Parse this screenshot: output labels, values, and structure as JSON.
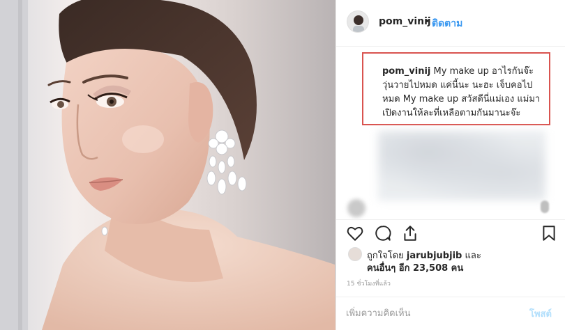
{
  "post": {
    "username": "pom_vinij",
    "follow_label": "ติดตาม",
    "separator": "•",
    "caption": {
      "username": "pom_vinij",
      "text": "My make up อาไรกันจ๊ะ วุ่นวายไปหมด แค่นี้นะ นะฮะ เจ็บคอไปหมด My make up สวัสดีนี่แม่เอง แม่มาเปิดงานให้ละที่เหลือตามกันมานะจ๊ะ"
    },
    "likes": {
      "prefix": "ถูกใจโดย",
      "first_liker": "jarubjubjib",
      "and_label": "และ",
      "others_label": "คนอื่นๆ อีก 23,508 คน"
    },
    "timestamp": "15 ชั่วโมงที่แล้ว",
    "comment_input": {
      "placeholder": "เพิ่มความคิดเห็น"
    },
    "post_button_label": "โพสต์"
  },
  "icons": {
    "like": "heart-icon",
    "comment": "comment-icon",
    "share": "share-icon",
    "save": "bookmark-icon"
  },
  "colors": {
    "follow_link": "#3897f0",
    "post_button_disabled": "#b2dffc",
    "highlight_border": "#d9534f",
    "timestamp": "#999999"
  }
}
